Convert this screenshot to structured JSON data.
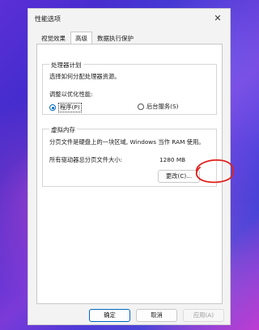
{
  "window": {
    "title": "性能选项",
    "close_glyph": "✕"
  },
  "tabs": [
    {
      "label": "视觉效果",
      "active": false
    },
    {
      "label": "高级",
      "active": true
    },
    {
      "label": "数据执行保护",
      "active": false
    }
  ],
  "processor": {
    "group_title": "处理器计划",
    "description": "选择如何分配处理器资源。",
    "adjust_label": "调整以优化性能:",
    "options": [
      {
        "label": "程序(P)",
        "selected": true
      },
      {
        "label": "后台服务(S)",
        "selected": false
      }
    ]
  },
  "virtual_memory": {
    "group_title": "虚拟内存",
    "description": "分页文件是硬盘上的一块区域, Windows 当作 RAM 使用。",
    "total_label": "所有驱动器总分页文件大小:",
    "total_value": "1280 MB",
    "change_button": "更改(C)..."
  },
  "footer": {
    "ok": "确定",
    "cancel": "取消",
    "apply": "应用(A)"
  },
  "colors": {
    "annotation": "#e0201b",
    "accent": "#0067c0"
  }
}
